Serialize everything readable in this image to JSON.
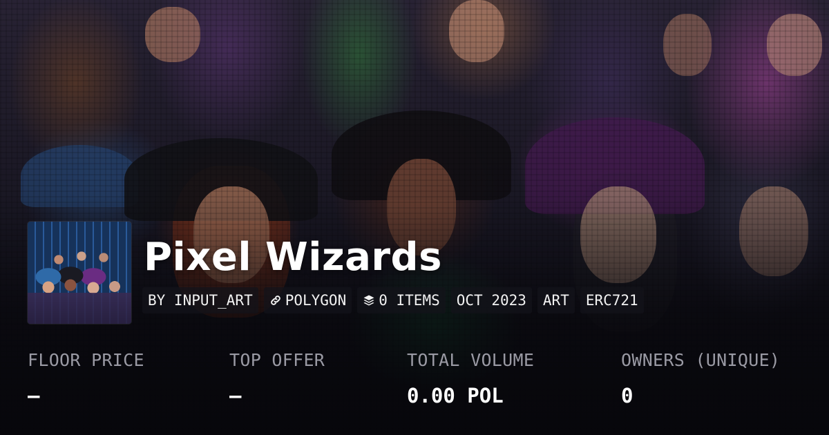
{
  "collection": {
    "name": "Pixel Wizards",
    "tags": [
      {
        "label": "BY INPUT_ART",
        "icon": null
      },
      {
        "label": "POLYGON",
        "icon": "chain-link-icon"
      },
      {
        "label": "0 ITEMS",
        "icon": "stack-layers-icon"
      },
      {
        "label": "OCT 2023",
        "icon": null
      },
      {
        "label": "ART",
        "icon": null
      },
      {
        "label": "ERC721",
        "icon": null
      }
    ]
  },
  "stats": [
    {
      "label": "FLOOR PRICE",
      "value": "–"
    },
    {
      "label": "TOP OFFER",
      "value": "–"
    },
    {
      "label": "TOTAL VOLUME",
      "value": "0.00 POL"
    },
    {
      "label": "OWNERS (UNIQUE)",
      "value": "0"
    }
  ],
  "colors": {
    "text": "#ffffff",
    "muted_label": "#9a9aa4",
    "tag_background": "rgba(20,20,26,0.72)"
  }
}
